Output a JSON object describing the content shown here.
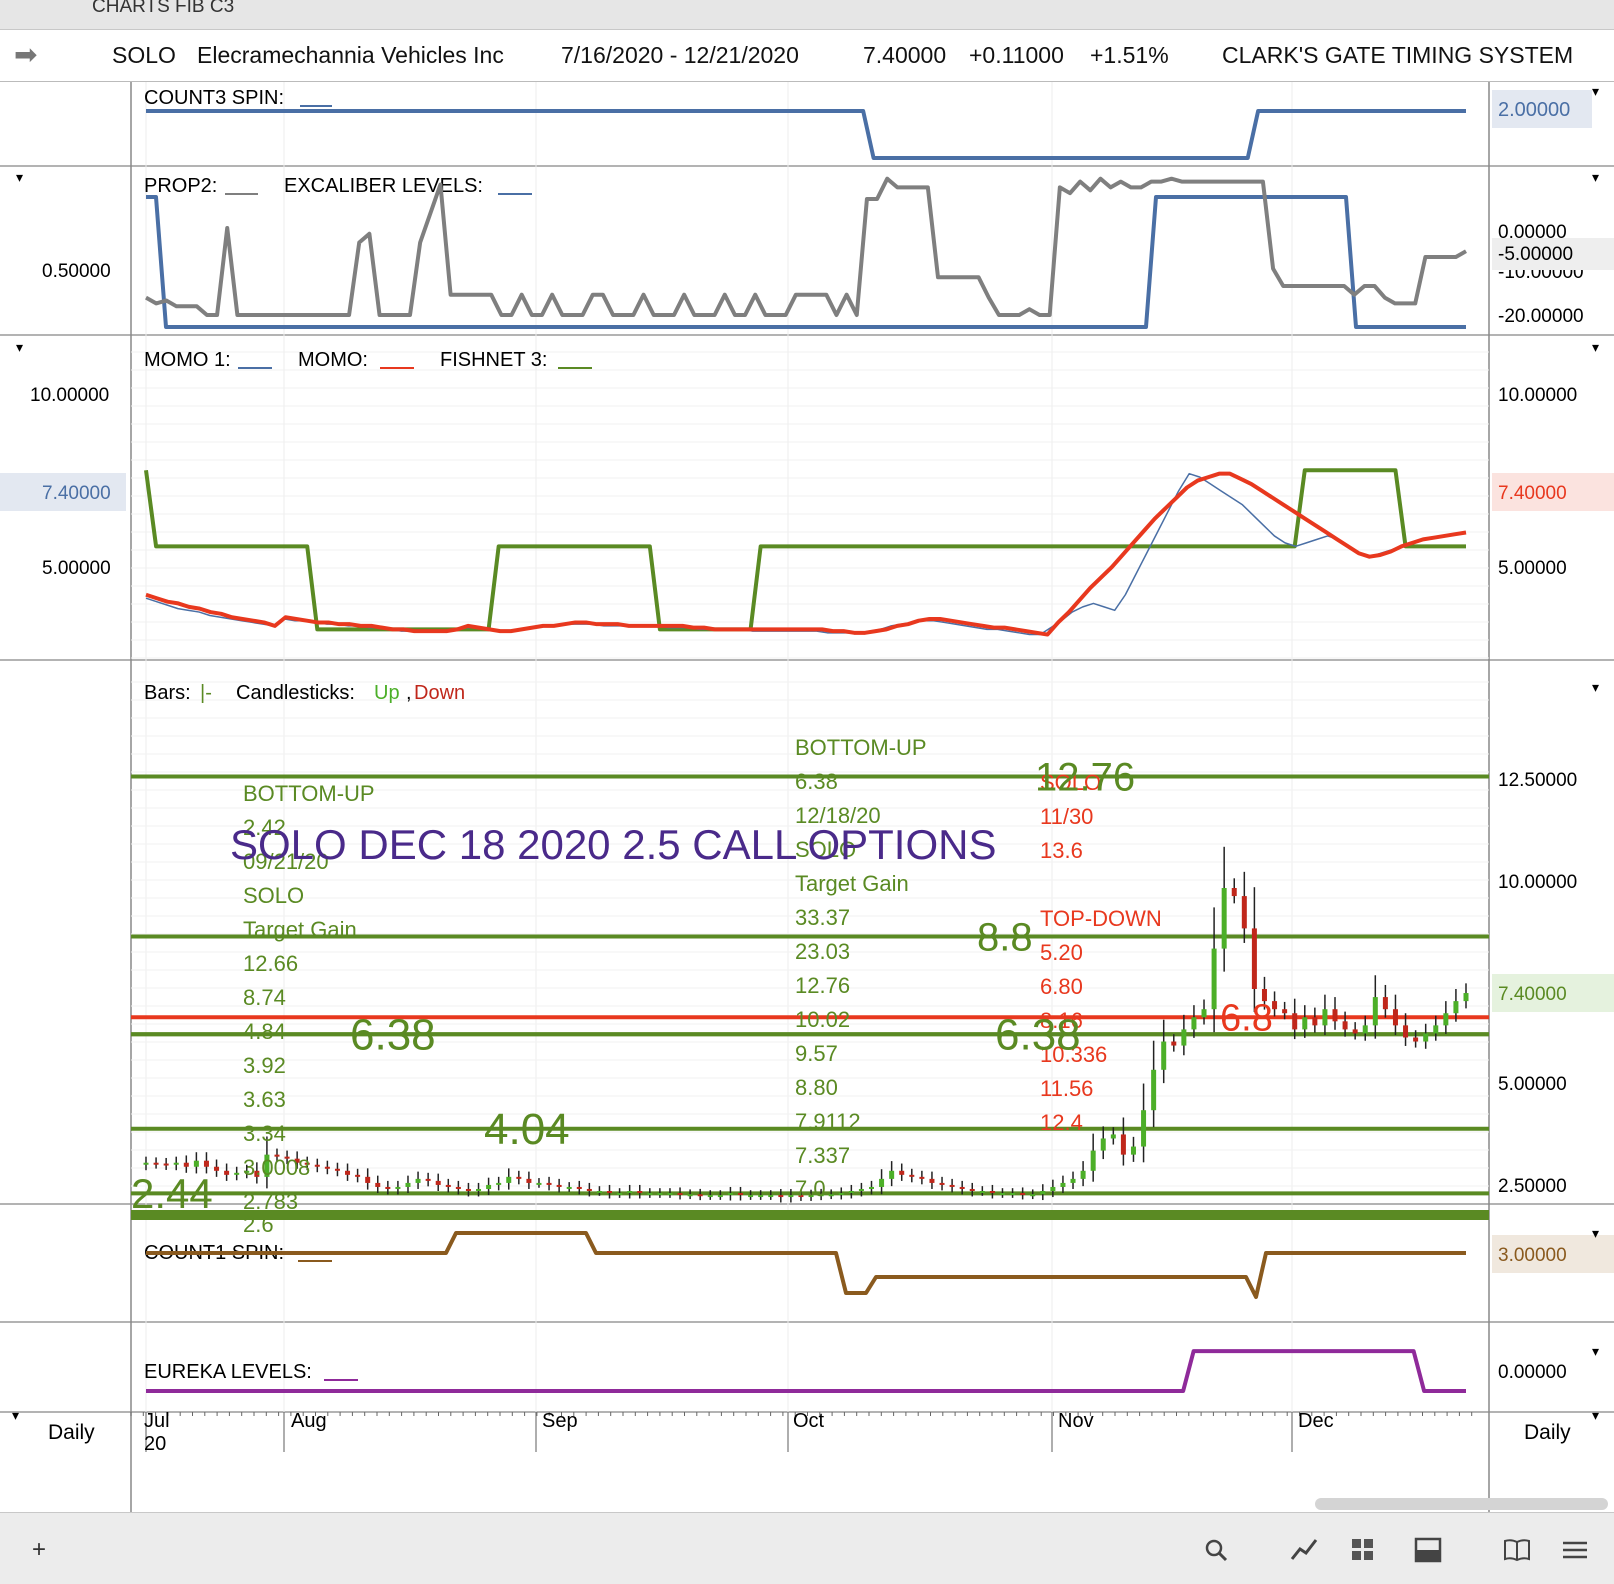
{
  "window": {
    "title": "CHARTS FIB C3"
  },
  "header": {
    "symbol": "SOLO",
    "company": "Elecramechannia Vehicles Inc",
    "date_range": "7/16/2020 - 12/21/2020",
    "price": "7.40000",
    "change": "+0.11000",
    "change_pct": "+1.51%",
    "system": "CLARK'S GATE TIMING SYSTEM"
  },
  "colors": {
    "green": "#5a8a23",
    "red": "#e8381e",
    "blue": "#4a6fa5",
    "gray": "#7f7f7f",
    "brown": "#8a5a1e",
    "purple": "#8f2a9a",
    "annotation": "#4a2a8a"
  },
  "panels": {
    "count3": {
      "label": "COUNT3 SPIN:",
      "value_tag": "2.00000",
      "series": [
        2,
        2,
        2,
        2,
        2,
        2,
        2,
        2,
        2,
        2,
        2,
        2,
        2,
        2,
        2,
        2,
        2,
        2,
        2,
        2,
        2,
        2,
        2,
        2,
        2,
        2,
        2,
        2,
        2,
        2,
        2,
        2,
        2,
        2,
        2,
        2,
        2,
        2,
        2,
        2,
        2,
        2,
        2,
        2,
        2,
        2,
        2,
        2,
        2,
        2,
        2,
        2,
        2,
        2,
        2,
        2,
        2,
        2,
        2,
        2,
        2,
        2,
        2,
        2,
        2,
        2,
        2,
        2,
        2,
        2,
        1,
        1,
        1,
        1,
        1,
        1,
        1,
        1,
        1,
        1,
        1,
        1,
        1,
        1,
        1,
        1,
        1,
        1,
        1,
        1,
        1,
        1,
        1,
        1,
        1,
        1,
        1,
        1,
        1,
        1,
        1,
        1,
        1,
        1,
        1,
        1,
        1,
        2,
        2,
        2,
        2,
        2,
        2,
        2,
        2,
        2,
        2,
        2,
        2,
        2,
        2,
        2,
        2,
        2,
        2,
        2,
        2,
        2
      ]
    },
    "prop2": {
      "labels": [
        "PROP2:",
        "EXCALIBER LEVELS:"
      ],
      "left_ticks": [
        "0.50000"
      ],
      "right_ticks": [
        "0.00000",
        "-10.00000",
        "-20.00000"
      ],
      "value_tag": "-5.00000",
      "gray": [
        -14,
        -16,
        -15,
        -17,
        -17,
        -17,
        -20,
        -20,
        10,
        -20,
        -20,
        -20,
        -20,
        -20,
        -20,
        -20,
        -20,
        -20,
        -20,
        -20,
        -20,
        5,
        8,
        -20,
        -20,
        -20,
        -20,
        5,
        15,
        25,
        -13,
        -13,
        -13,
        -13,
        -13,
        -20,
        -20,
        -13,
        -20,
        -20,
        -13,
        -20,
        -20,
        -20,
        -13,
        -13,
        -20,
        -20,
        -20,
        -13,
        -20,
        -20,
        -20,
        -13,
        -20,
        -20,
        -20,
        -13,
        -20,
        -20,
        -13,
        -20,
        -20,
        -20,
        -13,
        -13,
        -13,
        -13,
        -20,
        -13,
        -20,
        20,
        20,
        27,
        24,
        24,
        24,
        24,
        -7,
        -7,
        -7,
        -7,
        -7,
        -14,
        -20,
        -20,
        -20,
        -18,
        -20,
        -20,
        24,
        22,
        26,
        23,
        27,
        24,
        26,
        24,
        24,
        26,
        26,
        27,
        26,
        26,
        26,
        26,
        26,
        26,
        26,
        26,
        26,
        -4,
        -10,
        -10,
        -10,
        -10,
        -10,
        -10,
        -10,
        -13,
        -10,
        -10,
        -14,
        -16,
        -16,
        -16,
        0,
        0,
        0,
        0,
        2
      ],
      "blue": [
        1,
        1,
        0,
        0,
        0,
        0,
        0,
        0,
        0,
        0,
        0,
        0,
        0,
        0,
        0,
        0,
        0,
        0,
        0,
        0,
        0,
        0,
        0,
        0,
        0,
        0,
        0,
        0,
        0,
        0,
        0,
        0,
        0,
        0,
        0,
        0,
        0,
        0,
        0,
        0,
        0,
        0,
        0,
        0,
        0,
        0,
        0,
        0,
        0,
        0,
        0,
        0,
        0,
        0,
        0,
        0,
        0,
        0,
        0,
        0,
        0,
        0,
        0,
        0,
        0,
        0,
        0,
        0,
        0,
        0,
        0,
        0,
        0,
        0,
        0,
        0,
        0,
        0,
        0,
        0,
        0,
        0,
        0,
        0,
        0,
        0,
        0,
        0,
        0,
        0,
        0,
        0,
        0,
        0,
        0,
        0,
        0,
        0,
        0,
        0,
        0,
        1,
        1,
        1,
        1,
        1,
        1,
        1,
        1,
        1,
        1,
        1,
        1,
        1,
        1,
        1,
        1,
        1,
        1,
        1,
        1,
        0,
        0,
        0,
        0,
        0,
        0,
        0,
        0,
        0,
        0,
        0,
        0
      ]
    },
    "momo": {
      "labels": [
        "MOMO 1:",
        "MOMO:",
        "FISHNET 3:"
      ],
      "ticks": [
        "10.00000",
        "5.00000"
      ],
      "value_tag_left": "7.40000",
      "value_tag_right": "7.40000",
      "fishnet": [
        11,
        6.6,
        6.6,
        6.6,
        6.6,
        6.6,
        6.6,
        6.6,
        6.6,
        6.6,
        6.6,
        6.6,
        6.6,
        6.6,
        6.6,
        6.6,
        6.6,
        1.8,
        1.8,
        1.8,
        1.8,
        1.8,
        1.8,
        1.8,
        1.8,
        1.8,
        1.8,
        1.8,
        1.8,
        1.8,
        1.8,
        1.8,
        1.8,
        1.8,
        1.8,
        6.6,
        6.6,
        6.6,
        6.6,
        6.6,
        6.6,
        6.6,
        6.6,
        6.6,
        6.6,
        6.6,
        6.6,
        6.6,
        6.6,
        6.6,
        6.6,
        1.8,
        1.8,
        1.8,
        1.8,
        1.8,
        1.8,
        1.8,
        1.8,
        1.8,
        1.8,
        6.6,
        6.6,
        6.6,
        6.6,
        6.6,
        6.6,
        6.6,
        6.6,
        6.6,
        6.6,
        6.6,
        6.6,
        6.6,
        6.6,
        6.6,
        6.6,
        6.6,
        6.6,
        6.6,
        6.6,
        6.6,
        6.6,
        6.6,
        6.6,
        6.6,
        6.6,
        6.6,
        6.6,
        6.6,
        6.6,
        6.6,
        6.6,
        6.6,
        6.6,
        6.6,
        6.6,
        6.6,
        6.6,
        6.6,
        6.6,
        6.6,
        6.6,
        6.6,
        6.6,
        6.6,
        6.6,
        6.6,
        6.6,
        6.6,
        6.6,
        6.6,
        6.6,
        6.6,
        6.6,
        11,
        11,
        11,
        11,
        11,
        11,
        11,
        11,
        11,
        11,
        6.6,
        6.6,
        6.6,
        6.6,
        6.6,
        6.6,
        6.6
      ],
      "momo": [
        3.8,
        3.6,
        3.4,
        3.3,
        3.1,
        3,
        2.8,
        2.7,
        2.5,
        2.4,
        2.3,
        2.2,
        2,
        2.5,
        2.4,
        2.3,
        2.2,
        2.2,
        2.1,
        2.1,
        2,
        2,
        1.9,
        1.8,
        1.8,
        1.7,
        1.7,
        1.7,
        1.7,
        1.8,
        2,
        1.9,
        1.8,
        1.7,
        1.7,
        1.8,
        1.9,
        2,
        2,
        2.1,
        2.2,
        2.2,
        2.1,
        2.1,
        2.1,
        2,
        2,
        2,
        2,
        2,
        2,
        1.9,
        1.9,
        1.8,
        1.8,
        1.8,
        1.8,
        1.8,
        1.8,
        1.8,
        1.8,
        1.8,
        1.8,
        1.8,
        1.7,
        1.7,
        1.6,
        1.6,
        1.7,
        1.8,
        2,
        2.1,
        2.3,
        2.4,
        2.4,
        2.3,
        2.2,
        2.1,
        2,
        1.9,
        1.9,
        1.8,
        1.7,
        1.6,
        1.5,
        2.2,
        2.8,
        3.5,
        4.2,
        4.8,
        5.4,
        6.1,
        6.8,
        7.5,
        8.2,
        8.8,
        9.4,
        10,
        10.4,
        10.6,
        10.8,
        10.8,
        10.5,
        10.2,
        9.8,
        9.4,
        9,
        8.6,
        8.2,
        7.8,
        7.4,
        7,
        6.6,
        6.2,
        6,
        6.1,
        6.3,
        6.6,
        6.8,
        7,
        7.1,
        7.2,
        7.3,
        7.4
      ],
      "momo1": [
        3.6,
        3.4,
        3.2,
        3,
        2.9,
        2.8,
        2.6,
        2.5,
        2.4,
        2.3,
        2.2,
        2.1,
        2,
        2.4,
        2.3,
        2.3,
        2.2,
        2.1,
        2.1,
        2,
        2,
        1.9,
        1.9,
        1.8,
        1.7,
        1.7,
        1.7,
        1.7,
        1.7,
        1.8,
        1.9,
        1.9,
        1.8,
        1.7,
        1.7,
        1.8,
        1.9,
        2,
        2,
        2.1,
        2.1,
        2.1,
        2.1,
        2,
        2,
        2,
        2,
        2,
        2,
        1.9,
        1.9,
        1.9,
        1.8,
        1.8,
        1.8,
        1.8,
        1.8,
        1.7,
        1.7,
        1.7,
        1.7,
        1.7,
        1.7,
        1.7,
        1.6,
        1.6,
        1.6,
        1.6,
        1.7,
        1.8,
        2,
        2.1,
        2.2,
        2.3,
        2.3,
        2.2,
        2.1,
        2,
        1.9,
        1.8,
        1.8,
        1.7,
        1.6,
        1.5,
        1.5,
        1.9,
        2.3,
        2.8,
        3.1,
        3.3,
        3.1,
        2.9,
        3.8,
        5,
        6.2,
        7.4,
        8.6,
        9.8,
        10.8,
        10.6,
        10.2,
        9.8,
        9.4,
        9,
        8.4,
        7.8,
        7.2,
        6.8,
        6.6,
        6.8,
        7,
        7.2,
        7,
        6.5,
        6.2,
        6,
        6.2,
        6.4,
        6.6,
        6.8,
        7,
        7.1,
        7.2,
        7.3,
        7.4
      ]
    },
    "main": {
      "legend_bars": "Bars:",
      "legend_bar_glyph": "|-",
      "legend_candles": "Candlesticks:",
      "legend_up": "Up",
      "legend_comma": ",",
      "legend_down": "Down",
      "ticks": [
        "12.50000",
        "10.00000",
        "5.00000",
        "2.50000"
      ],
      "value_tag": "7.40000",
      "levels_green": [
        12.76,
        8.8,
        6.38,
        4.04,
        2.44
      ],
      "level_red": 6.8,
      "level_labels": [
        {
          "text": "12.76",
          "value": 12.76
        },
        {
          "text": "8.8",
          "value": 8.8
        },
        {
          "text": "6.38",
          "value": 6.38
        },
        {
          "text": "6.38",
          "value": 6.38
        },
        {
          "text": "4.04",
          "value": 4.04
        },
        {
          "text": "2.44",
          "value": 2.44
        },
        {
          "text": "6.8",
          "value": 6.8
        }
      ],
      "col1": [
        "BOTTOM-UP",
        "2.42",
        "09/21/20",
        "SOLO",
        "Target Gain",
        "12.66",
        "8.74",
        "4.84",
        "3.92",
        "3.63",
        "3.34",
        "3.0008",
        "2.783",
        "2.6"
      ],
      "col2": [
        "BOTTOM-UP",
        "6.38",
        "12/18/20",
        "SOLO",
        "Target Gain",
        "33.37",
        "23.03",
        "12.76",
        "10.02",
        "9.57",
        "8.80",
        "7.9112",
        "7.337",
        "7.0"
      ],
      "col3": [
        "SOLO",
        "11/30",
        "13.6",
        "",
        "TOP-DOWN",
        "5.20",
        "6.80",
        "8.16",
        "10.336",
        "11.56",
        "12.4"
      ],
      "annotation": "SOLO DEC 18 2020 2.5 CALL OPTIONS",
      "closes": [
        3.2,
        3.18,
        3.15,
        3.2,
        3.1,
        3.25,
        3.1,
        3.0,
        2.9,
        2.95,
        3.0,
        2.85,
        3.4,
        3.35,
        3.3,
        3.2,
        3.15,
        3.1,
        3.05,
        3.0,
        2.9,
        2.85,
        2.7,
        2.6,
        2.55,
        2.6,
        2.7,
        2.8,
        2.75,
        2.65,
        2.6,
        2.55,
        2.5,
        2.55,
        2.65,
        2.7,
        2.85,
        2.8,
        2.7,
        2.7,
        2.65,
        2.6,
        2.6,
        2.55,
        2.5,
        2.5,
        2.45,
        2.45,
        2.5,
        2.45,
        2.45,
        2.45,
        2.45,
        2.42,
        2.42,
        2.4,
        2.4,
        2.4,
        2.45,
        2.4,
        2.4,
        2.4,
        2.4,
        2.35,
        2.4,
        2.38,
        2.4,
        2.42,
        2.42,
        2.45,
        2.5,
        2.55,
        2.6,
        2.8,
        3.0,
        2.9,
        2.85,
        2.8,
        2.7,
        2.65,
        2.6,
        2.55,
        2.5,
        2.5,
        2.45,
        2.45,
        2.45,
        2.42,
        2.42,
        2.5,
        2.6,
        2.7,
        2.8,
        3.0,
        3.5,
        3.8,
        3.9,
        3.4,
        3.6,
        4.5,
        5.5,
        6.2,
        6.1,
        6.5,
        6.8,
        7.0,
        8.5,
        10.0,
        9.8,
        9.0,
        7.5,
        7.2,
        7.0,
        6.9,
        6.5,
        6.8,
        6.6,
        7.0,
        6.7,
        6.5,
        6.4,
        6.6,
        7.3,
        7.0,
        6.6,
        6.3,
        6.2,
        6.4,
        6.6,
        6.9,
        7.2,
        7.4
      ]
    },
    "count1": {
      "label": "COUNT1 SPIN:",
      "value_tag": "3.00000",
      "series": [
        3,
        3,
        3,
        3,
        3,
        3,
        3,
        3,
        3,
        3,
        3,
        3,
        3,
        3,
        3,
        3,
        3,
        3,
        3,
        3,
        3,
        3,
        3,
        3,
        3,
        3,
        3,
        3,
        3,
        3,
        3,
        4,
        4,
        4,
        4,
        4,
        4,
        4,
        4,
        4,
        4,
        4,
        4,
        4,
        4,
        3,
        3,
        3,
        3,
        3,
        3,
        3,
        3,
        3,
        3,
        3,
        3,
        3,
        3,
        3,
        3,
        3,
        3,
        3,
        3,
        3,
        3,
        3,
        3,
        3,
        1,
        1,
        1,
        1.8,
        1.8,
        1.8,
        1.8,
        1.8,
        1.8,
        1.8,
        1.8,
        1.8,
        1.8,
        1.8,
        1.8,
        1.8,
        1.8,
        1.8,
        1.8,
        1.8,
        1.8,
        1.8,
        1.8,
        1.8,
        1.8,
        1.8,
        1.8,
        1.8,
        1.8,
        1.8,
        1.8,
        1.8,
        1.8,
        1.8,
        1.8,
        1.8,
        1.8,
        1.8,
        1.8,
        1.8,
        1.8,
        0.8,
        3,
        3,
        3,
        3,
        3,
        3,
        3,
        3,
        3,
        3,
        3,
        3,
        3,
        3,
        3,
        3,
        3,
        3,
        3,
        3,
        3
      ]
    },
    "eureka": {
      "label": "EUREKA LEVELS:",
      "value_tag": "0.00000",
      "series": [
        -1,
        -1,
        -1,
        -1,
        -1,
        -1,
        -1,
        -1,
        -1,
        -1,
        -1,
        -1,
        -1,
        -1,
        -1,
        -1,
        -1,
        -1,
        -1,
        -1,
        -1,
        -1,
        -1,
        -1,
        -1,
        -1,
        -1,
        -1,
        -1,
        -1,
        -1,
        -1,
        -1,
        -1,
        -1,
        -1,
        -1,
        -1,
        -1,
        -1,
        -1,
        -1,
        -1,
        -1,
        -1,
        -1,
        -1,
        -1,
        -1,
        -1,
        -1,
        -1,
        -1,
        -1,
        -1,
        -1,
        -1,
        -1,
        -1,
        -1,
        -1,
        -1,
        -1,
        -1,
        -1,
        -1,
        -1,
        -1,
        -1,
        -1,
        -1,
        -1,
        -1,
        -1,
        -1,
        -1,
        -1,
        -1,
        -1,
        -1,
        -1,
        -1,
        -1,
        -1,
        -1,
        -1,
        -1,
        -1,
        -1,
        -1,
        -1,
        -1,
        -1,
        -1,
        -1,
        -1,
        -1,
        -1,
        -1,
        -1,
        0.4,
        0.4,
        0.4,
        0.4,
        0.4,
        0.4,
        0.4,
        0.4,
        0.4,
        0.4,
        0.4,
        0.4,
        0.4,
        0.4,
        0.4,
        0.4,
        0.4,
        0.4,
        0.4,
        0.4,
        0.4,
        0.4,
        -1,
        -1,
        -1,
        -1,
        -1
      ]
    }
  },
  "xaxis": {
    "months": [
      "Jul",
      "Aug",
      "Sep",
      "Oct",
      "Nov",
      "Dec"
    ],
    "year": "20",
    "period_left": "Daily",
    "period_right": "Daily"
  },
  "chart_data": {
    "type": "candlestick",
    "title": "SOLO Elecramechannia Vehicles Inc 7/16/2020 - 12/21/2020",
    "x_range": [
      "7/16/2020",
      "12/21/2020"
    ],
    "last_close": 7.4,
    "change": 0.11,
    "change_pct": 1.51,
    "y_ticks": [
      2.5,
      5.0,
      10.0,
      12.5
    ],
    "fib_levels": [
      12.76,
      8.8,
      6.8,
      6.38,
      4.04,
      2.44
    ]
  },
  "bottom": {
    "add": "+",
    "icons": [
      "search-icon",
      "chart-style-icon",
      "layout-icon",
      "panel-icon",
      "book-icon",
      "menu-icon"
    ]
  }
}
